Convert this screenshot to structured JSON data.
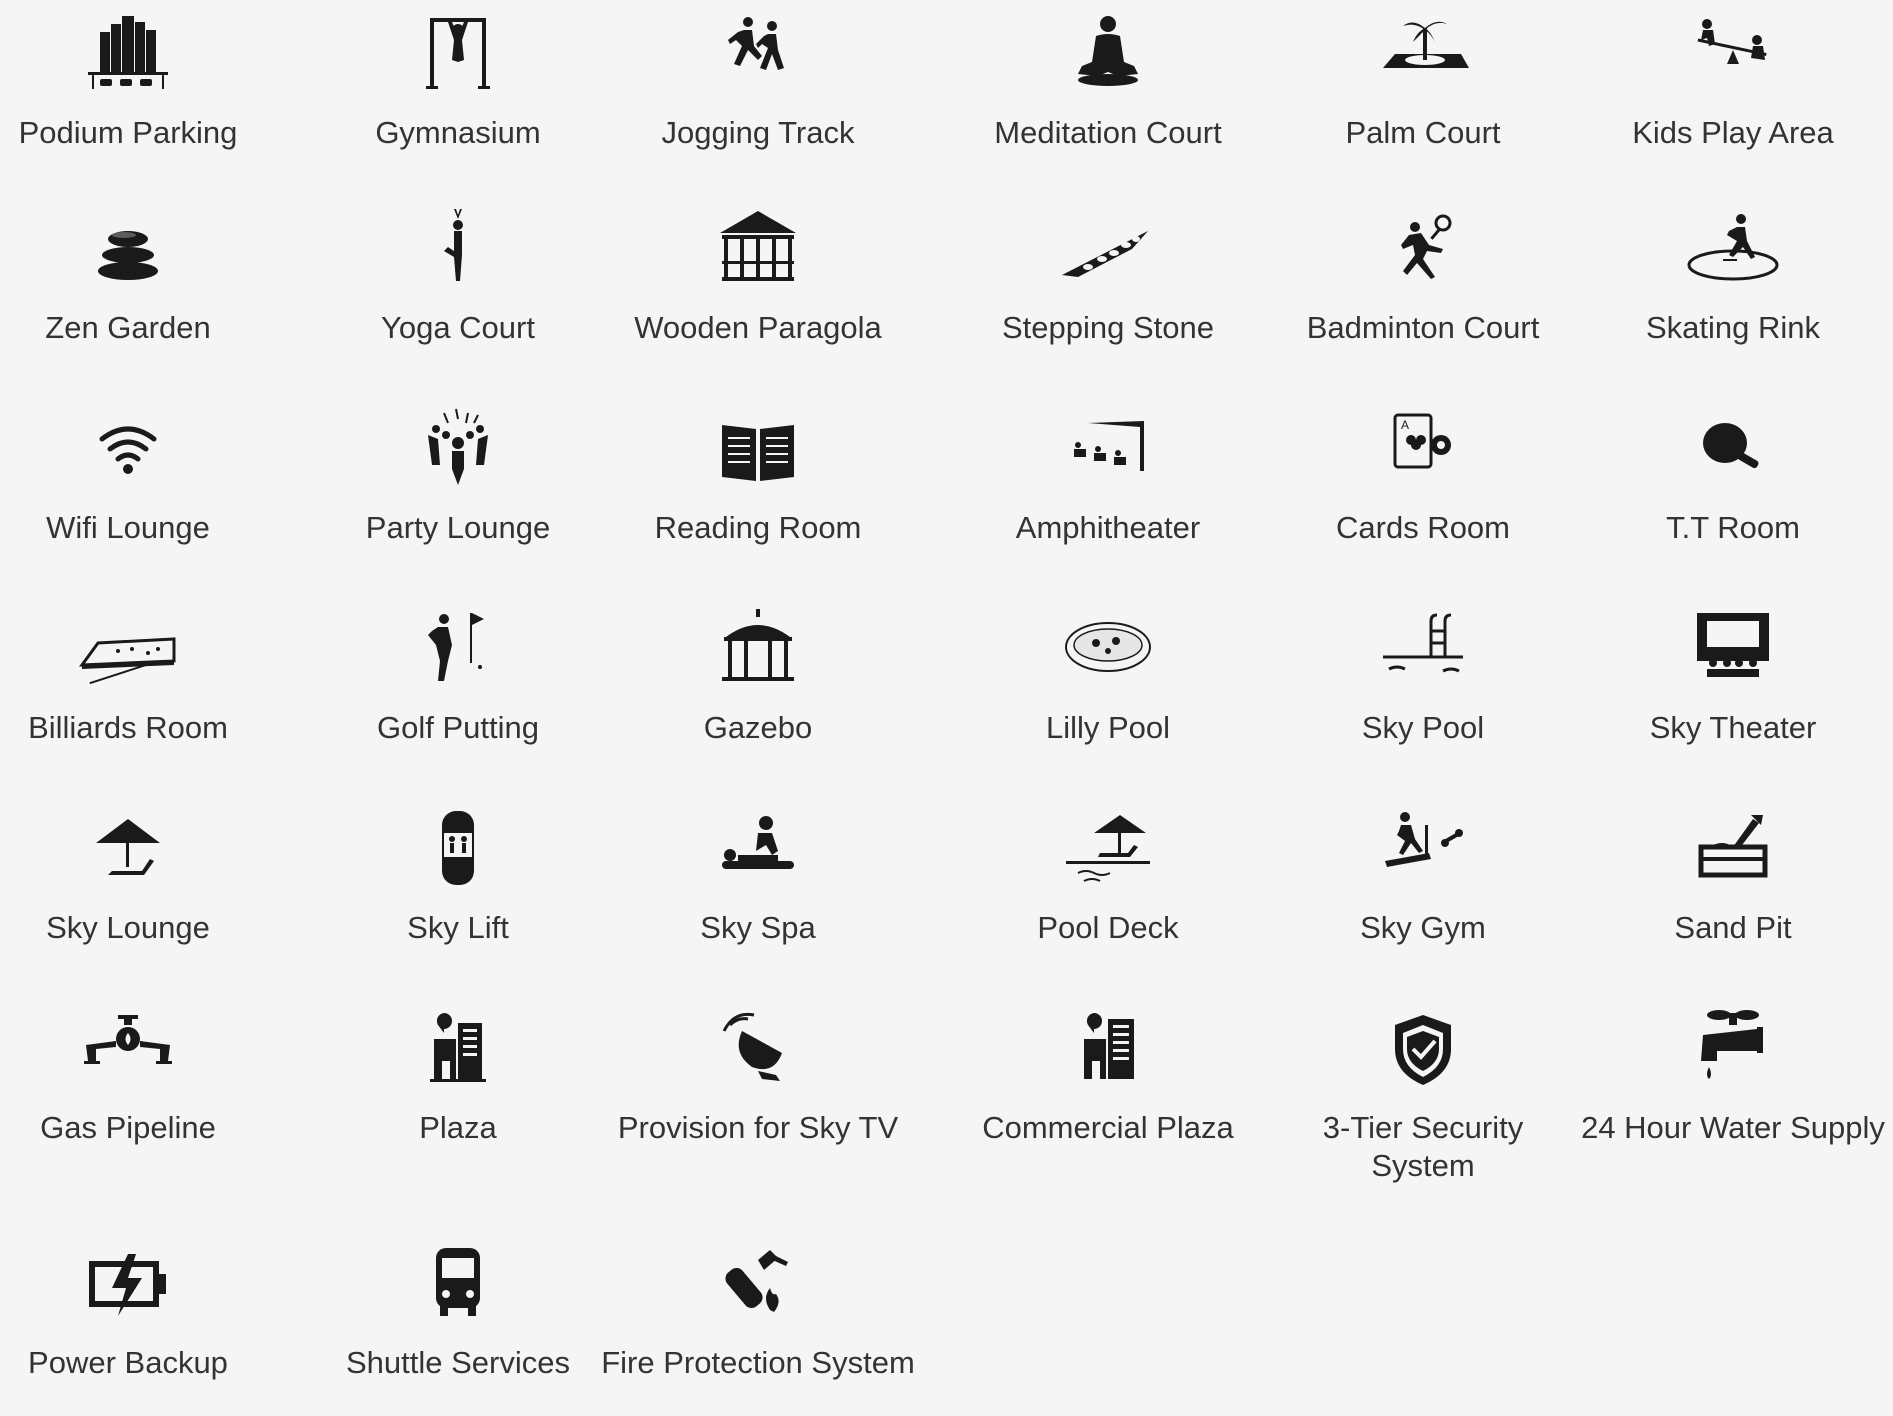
{
  "accent_color": "#1a1a1a",
  "text_color": "#333333",
  "background_color": "#f5f5f5",
  "amenities": [
    {
      "label": "Podium Parking",
      "icon": "podium-parking-icon"
    },
    {
      "label": "Gymnasium",
      "icon": "gymnasium-icon"
    },
    {
      "label": "Jogging Track",
      "icon": "jogging-track-icon"
    },
    {
      "label": "Meditation Court",
      "icon": "meditation-icon"
    },
    {
      "label": "Palm Court",
      "icon": "palm-court-icon"
    },
    {
      "label": "Kids Play Area",
      "icon": "kids-play-icon"
    },
    {
      "label": "Zen Garden",
      "icon": "zen-stones-icon"
    },
    {
      "label": "Yoga Court",
      "icon": "yoga-icon"
    },
    {
      "label": "Wooden Paragola",
      "icon": "pergola-icon"
    },
    {
      "label": "Stepping Stone",
      "icon": "stepping-stone-icon"
    },
    {
      "label": "Badminton Court",
      "icon": "badminton-icon"
    },
    {
      "label": "Skating Rink",
      "icon": "skating-icon"
    },
    {
      "label": "Wifi Lounge",
      "icon": "wifi-icon"
    },
    {
      "label": "Party Lounge",
      "icon": "party-icon"
    },
    {
      "label": "Reading Room",
      "icon": "book-icon"
    },
    {
      "label": "Amphitheater",
      "icon": "amphitheater-icon"
    },
    {
      "label": "Cards Room",
      "icon": "playing-card-icon"
    },
    {
      "label": "T.T Room",
      "icon": "table-tennis-icon"
    },
    {
      "label": "Billiards Room",
      "icon": "billiards-table-icon"
    },
    {
      "label": "Golf Putting",
      "icon": "golf-icon"
    },
    {
      "label": "Gazebo",
      "icon": "gazebo-icon"
    },
    {
      "label": "Lilly Pool",
      "icon": "lily-pool-icon"
    },
    {
      "label": "Sky Pool",
      "icon": "swimming-pool-icon"
    },
    {
      "label": "Sky Theater",
      "icon": "theater-icon"
    },
    {
      "label": "Sky Lounge",
      "icon": "lounge-umbrella-icon"
    },
    {
      "label": "Sky Lift",
      "icon": "elevator-icon"
    },
    {
      "label": "Sky Spa",
      "icon": "massage-icon"
    },
    {
      "label": "Pool Deck",
      "icon": "pool-deck-icon"
    },
    {
      "label": "Sky Gym",
      "icon": "treadmill-icon"
    },
    {
      "label": "Sand Pit",
      "icon": "sand-pit-icon"
    },
    {
      "label": "Gas Pipeline",
      "icon": "gas-pipe-icon"
    },
    {
      "label": "Plaza",
      "icon": "plaza-icon"
    },
    {
      "label": "Provision for Sky TV",
      "icon": "satellite-dish-icon"
    },
    {
      "label": "Commercial Plaza",
      "icon": "commercial-plaza-icon"
    },
    {
      "label": "3-Tier Security\nSystem",
      "icon": "security-shield-icon"
    },
    {
      "label": "24 Hour Water Supply",
      "icon": "water-tap-icon"
    },
    {
      "label": "Power Backup",
      "icon": "battery-charging-icon"
    },
    {
      "label": "Shuttle Services",
      "icon": "bus-icon"
    },
    {
      "label": "Fire Protection System",
      "icon": "fire-extinguisher-icon"
    }
  ]
}
